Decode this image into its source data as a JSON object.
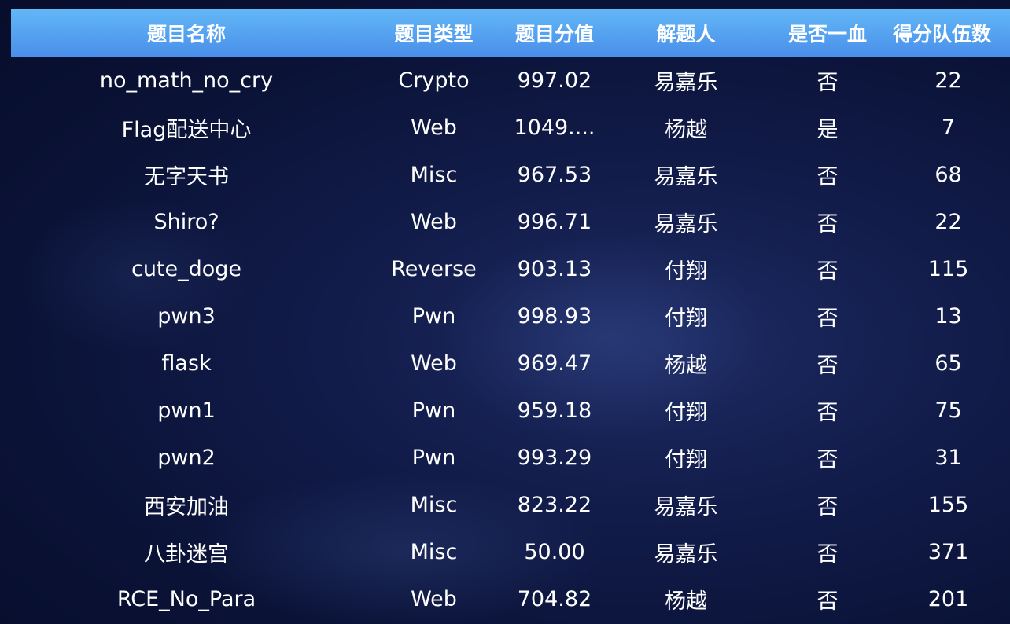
{
  "table": {
    "columns": [
      "题目名称",
      "题目类型",
      "题目分值",
      "解题人",
      "是否一血",
      "得分队伍数"
    ],
    "rows": [
      [
        "no_math_no_cry",
        "Crypto",
        "997.02",
        "易嘉乐",
        "否",
        "22"
      ],
      [
        "Flag配送中心",
        "Web",
        "1049....",
        "杨越",
        "是",
        "7"
      ],
      [
        "无字天书",
        "Misc",
        "967.53",
        "易嘉乐",
        "否",
        "68"
      ],
      [
        "Shiro?",
        "Web",
        "996.71",
        "易嘉乐",
        "否",
        "22"
      ],
      [
        "cute_doge",
        "Reverse",
        "903.13",
        "付翔",
        "否",
        "115"
      ],
      [
        "pwn3",
        "Pwn",
        "998.93",
        "付翔",
        "否",
        "13"
      ],
      [
        "flask",
        "Web",
        "969.47",
        "杨越",
        "否",
        "65"
      ],
      [
        "pwn1",
        "Pwn",
        "959.18",
        "付翔",
        "否",
        "75"
      ],
      [
        "pwn2",
        "Pwn",
        "993.29",
        "付翔",
        "否",
        "31"
      ],
      [
        "西安加油",
        "Misc",
        "823.22",
        "易嘉乐",
        "否",
        "155"
      ],
      [
        "八卦迷宫",
        "Misc",
        "50.00",
        "易嘉乐",
        "否",
        "371"
      ],
      [
        "RCE_No_Para",
        "Web",
        "704.82",
        "杨越",
        "否",
        "201"
      ]
    ]
  },
  "colors": {
    "header_top": "#62b7f7",
    "header_bottom": "#4a8fea",
    "background": "#0a1236",
    "text": "#ffffff"
  }
}
